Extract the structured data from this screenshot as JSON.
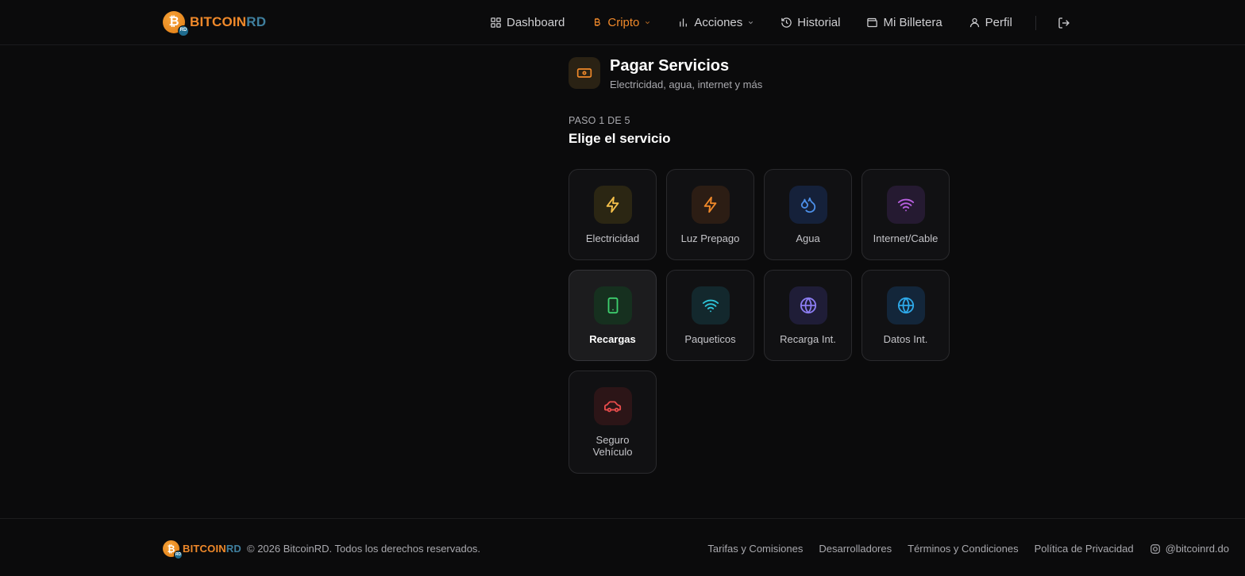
{
  "brand": {
    "part1": "BITCOIN",
    "part2": "RD",
    "coin_symbol": "₿",
    "badge": "RD",
    "primary_color": "#f0892a",
    "secondary_color": "#3f7f9e"
  },
  "nav": {
    "items": [
      {
        "label": "Dashboard",
        "icon": "grid-icon"
      },
      {
        "label": "Cripto",
        "icon": "bitcoin-icon",
        "active": true,
        "dropdown": true
      },
      {
        "label": "Acciones",
        "icon": "bar-chart-icon",
        "dropdown": true
      },
      {
        "label": "Historial",
        "icon": "history-icon"
      },
      {
        "label": "Mi Billetera",
        "icon": "wallet-icon"
      },
      {
        "label": "Perfil",
        "icon": "user-icon"
      }
    ],
    "logout_icon": "logout-icon"
  },
  "page": {
    "title": "Pagar Servicios",
    "subtitle": "Electricidad, agua, internet y más",
    "icon": "banknote-icon"
  },
  "step": {
    "indicator": "PASO 1 DE 5",
    "title": "Elige el servicio"
  },
  "services": [
    {
      "label": "Electricidad",
      "icon": "bolt-icon",
      "color": "#f5c04a",
      "bg": "#2b2613"
    },
    {
      "label": "Luz Prepago",
      "icon": "bolt-icon",
      "color": "#f0892a",
      "bg": "#2c1d14"
    },
    {
      "label": "Agua",
      "icon": "droplets-icon",
      "color": "#4c8fe8",
      "bg": "#15213a"
    },
    {
      "label": "Internet/Cable",
      "icon": "wifi-icon",
      "color": "#b860e0",
      "bg": "#251a31"
    },
    {
      "label": "Recargas",
      "icon": "smartphone-icon",
      "color": "#3ecf6e",
      "bg": "#16301f",
      "selected": true
    },
    {
      "label": "Paqueticos",
      "icon": "wifi-icon",
      "color": "#2ec4d9",
      "bg": "#13282d"
    },
    {
      "label": "Recarga Int.",
      "icon": "globe-icon",
      "color": "#8b7cf0",
      "bg": "#1f1d37"
    },
    {
      "label": "Datos Int.",
      "icon": "globe-icon",
      "color": "#2ea8e8",
      "bg": "#13263a"
    },
    {
      "label": "Seguro Vehículo",
      "icon": "car-icon",
      "color": "#e84c4c",
      "bg": "#2c1517"
    }
  ],
  "footer": {
    "copyright": "© 2026 BitcoinRD. Todos los derechos reservados.",
    "links": [
      "Tarifas y Comisiones",
      "Desarrolladores",
      "Términos y Condiciones",
      "Política de Privacidad"
    ],
    "instagram": "@bitcoinrd.do"
  }
}
